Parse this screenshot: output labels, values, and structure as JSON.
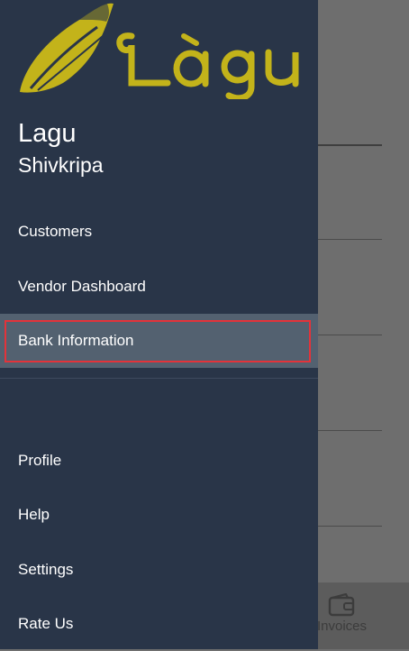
{
  "brand": {
    "logo_text": "Lagu",
    "logo_color": "#c3b31a"
  },
  "user": {
    "name": "Lagu",
    "subtitle": "Shivkripa"
  },
  "menu": {
    "primary": [
      {
        "label": "Customers"
      },
      {
        "label": "Vendor Dashboard"
      },
      {
        "label": "Bank Information",
        "active": true
      }
    ],
    "secondary": [
      {
        "label": "Profile"
      },
      {
        "label": "Help"
      },
      {
        "label": "Settings"
      },
      {
        "label": "Rate Us"
      }
    ]
  },
  "background": {
    "tab_label": "Invoices",
    "tab_icon": "wallet-icon"
  },
  "colors": {
    "drawer_bg": "#293548",
    "active_bg": "#536170",
    "highlight_border": "#e3333a"
  }
}
